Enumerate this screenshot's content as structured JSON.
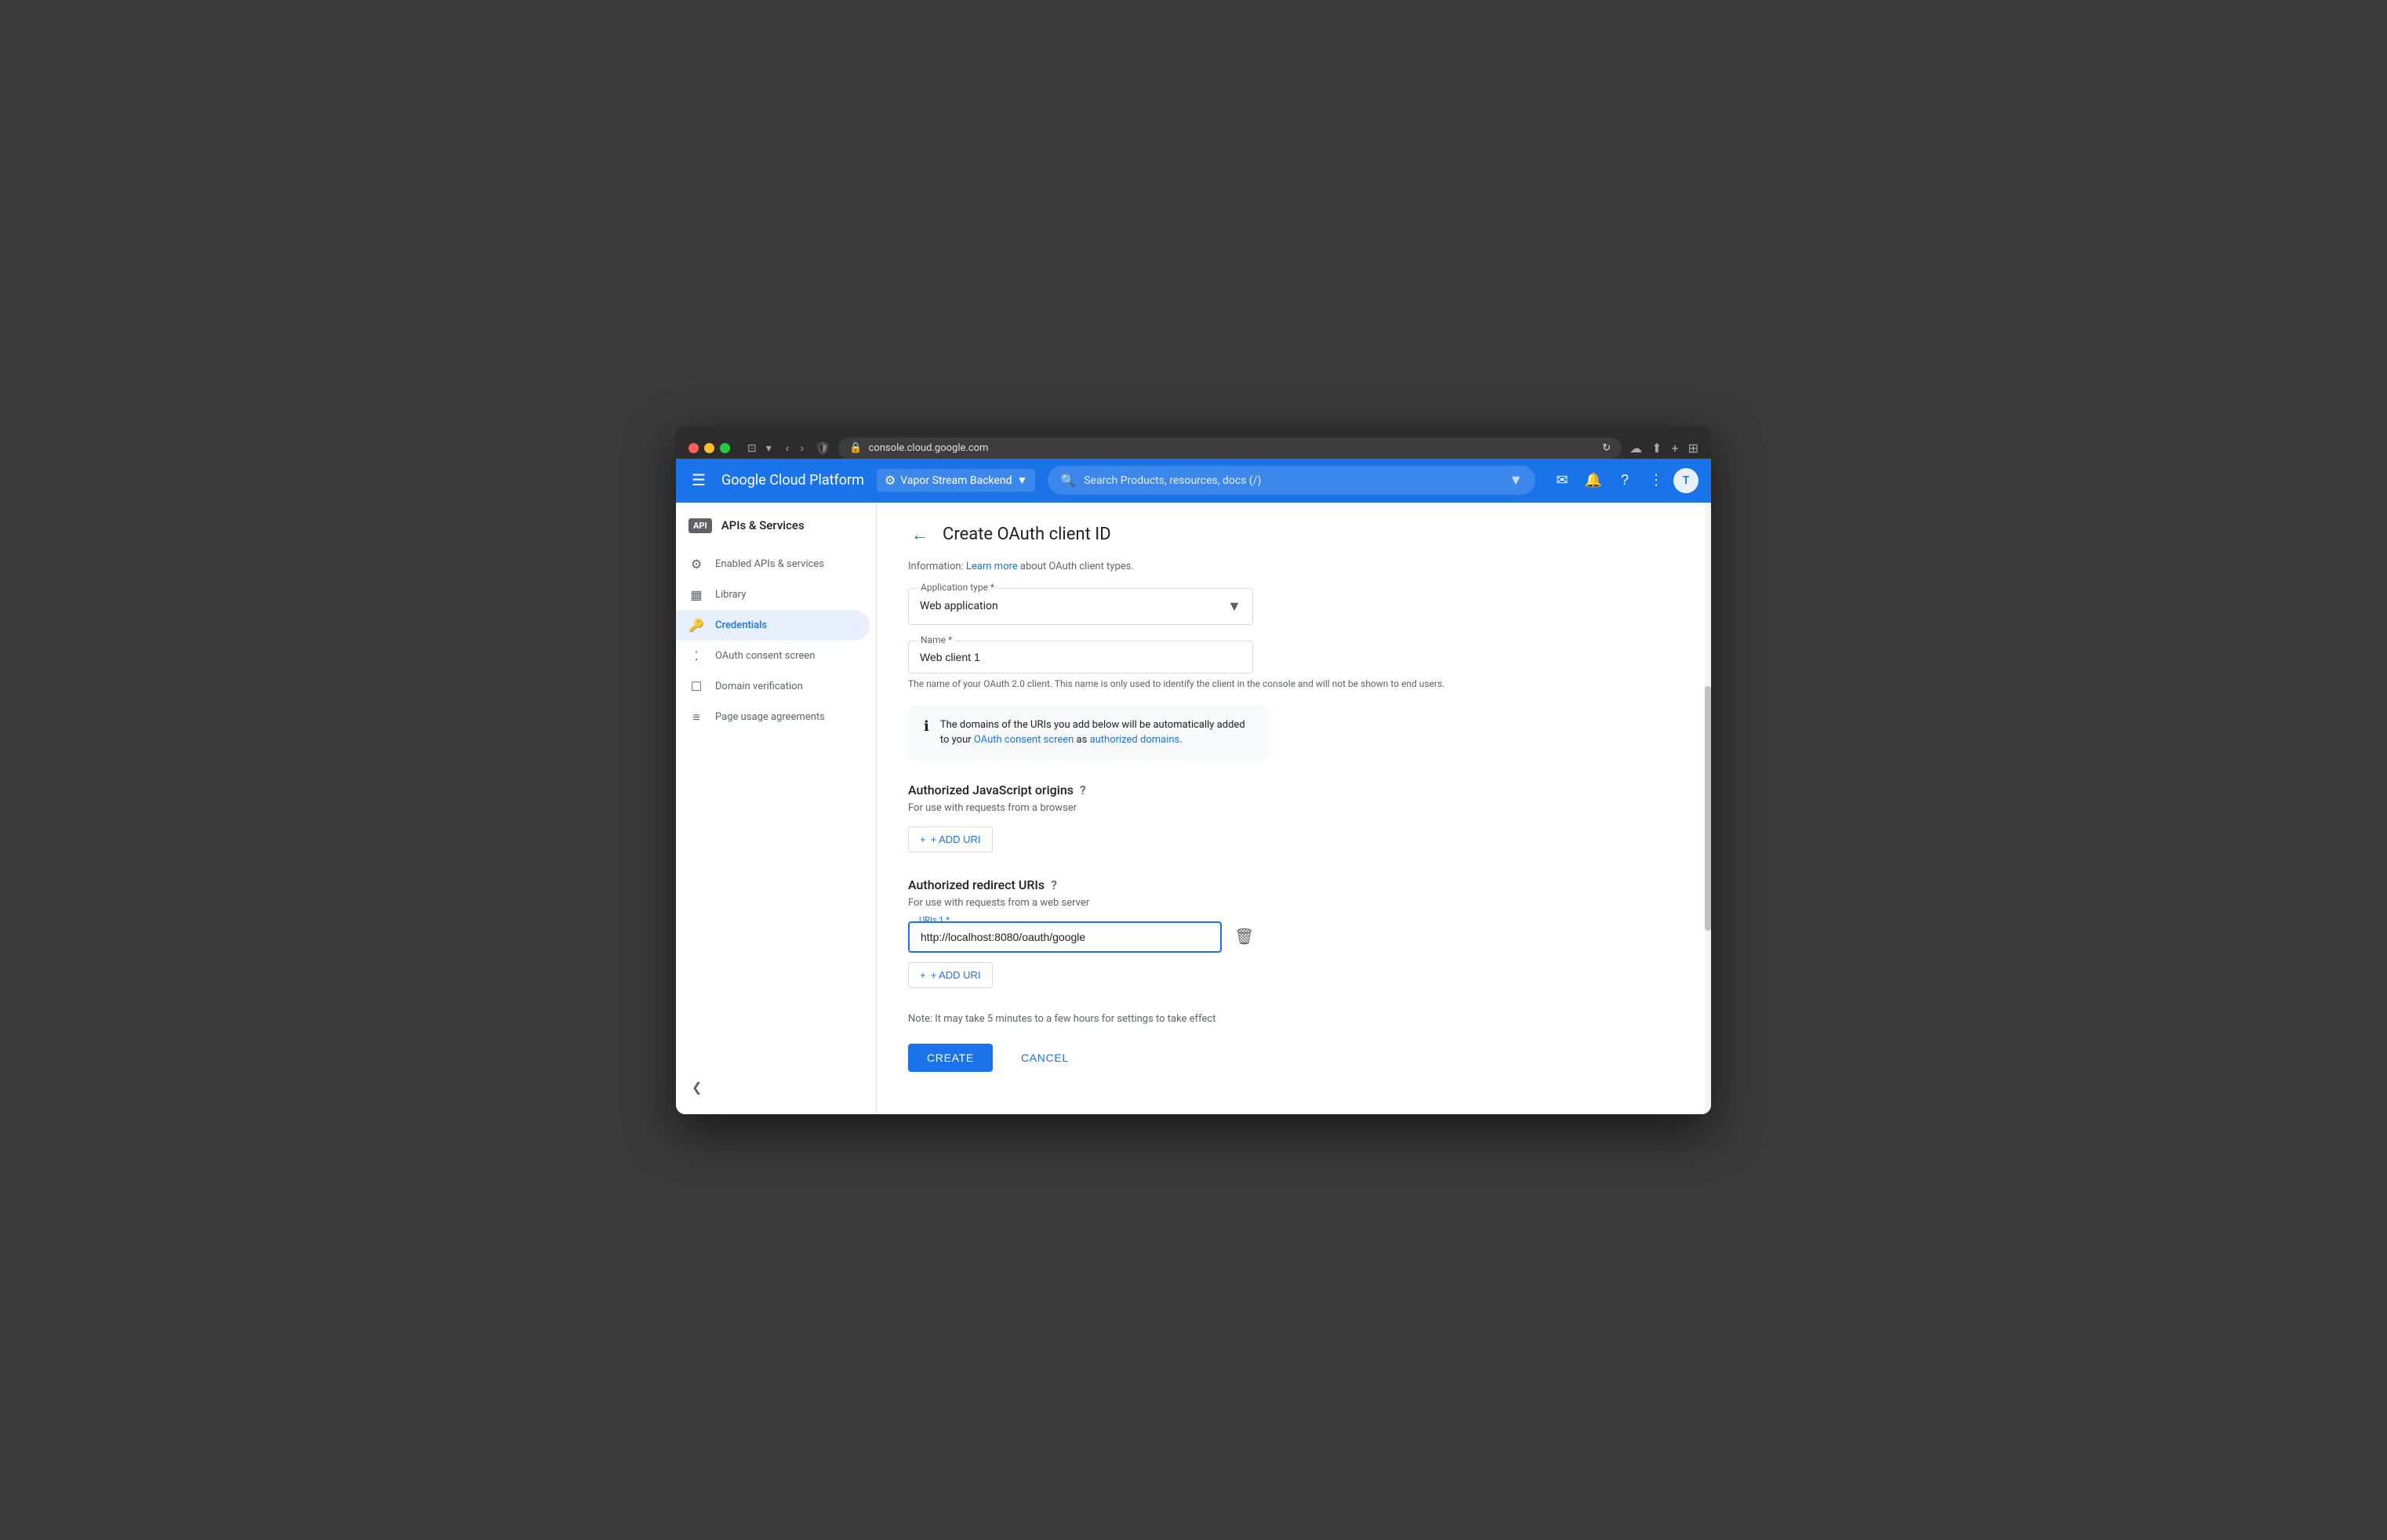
{
  "browser": {
    "url": "console.cloud.google.com",
    "back_label": "←",
    "forward_label": "→"
  },
  "topnav": {
    "hamburger_label": "☰",
    "brand": "Google Cloud Platform",
    "project_name": "Vapor Stream Backend",
    "project_dropdown_icon": "▼",
    "search_placeholder": "Search  Products, resources, docs (/)",
    "search_dropdown": "▼",
    "user_initial": "T"
  },
  "sidebar": {
    "api_badge": "API",
    "title": "APIs & Services",
    "nav_items": [
      {
        "id": "enabled",
        "icon": "⚙",
        "label": "Enabled APIs & services"
      },
      {
        "id": "library",
        "icon": "▦",
        "label": "Library"
      },
      {
        "id": "credentials",
        "icon": "🔑",
        "label": "Credentials",
        "active": true
      },
      {
        "id": "oauth",
        "icon": "⁚",
        "label": "OAuth consent screen"
      },
      {
        "id": "domain",
        "icon": "☐",
        "label": "Domain verification"
      },
      {
        "id": "page",
        "icon": "≡",
        "label": "Page usage agreements"
      }
    ],
    "collapse_icon": "❮"
  },
  "page": {
    "back_icon": "←",
    "title": "Create OAuth client ID",
    "info_text_prefix": "Information: ",
    "info_link_text": "Learn more",
    "info_link_suffix": " about OAuth client types.",
    "app_type_label": "Application type *",
    "app_type_value": "Web application",
    "app_type_dropdown": "▼",
    "name_label": "Name *",
    "name_value": "Web client 1",
    "name_helper": "The name of your OAuth 2.0 client. This name is only used to identify the client in the console and will not be shown to end users.",
    "info_box_icon": "ℹ",
    "info_box_text_prefix": "The domains of the URIs you add below will be automatically added to your ",
    "info_box_link1": "OAuth consent screen",
    "info_box_text_middle": " as ",
    "info_box_link2": "authorized domains",
    "info_box_text_suffix": ".",
    "js_origins_title": "Authorized JavaScript origins",
    "js_origins_help": "?",
    "js_origins_subtitle": "For use with requests from a browser",
    "add_uri_label_js": "+ ADD URI",
    "redirect_uris_title": "Authorized redirect URIs",
    "redirect_uris_help": "?",
    "redirect_uris_subtitle": "For use with requests from a web server",
    "uri_field_label": "URIs 1 *",
    "uri_value": "http://localhost:8080/oauth/google",
    "add_uri_label_redirect": "+ ADD URI",
    "delete_icon": "🗑",
    "note": "Note: It may take 5 minutes to a few hours for settings to take effect",
    "create_btn": "CREATE",
    "cancel_btn": "CANCEL"
  }
}
